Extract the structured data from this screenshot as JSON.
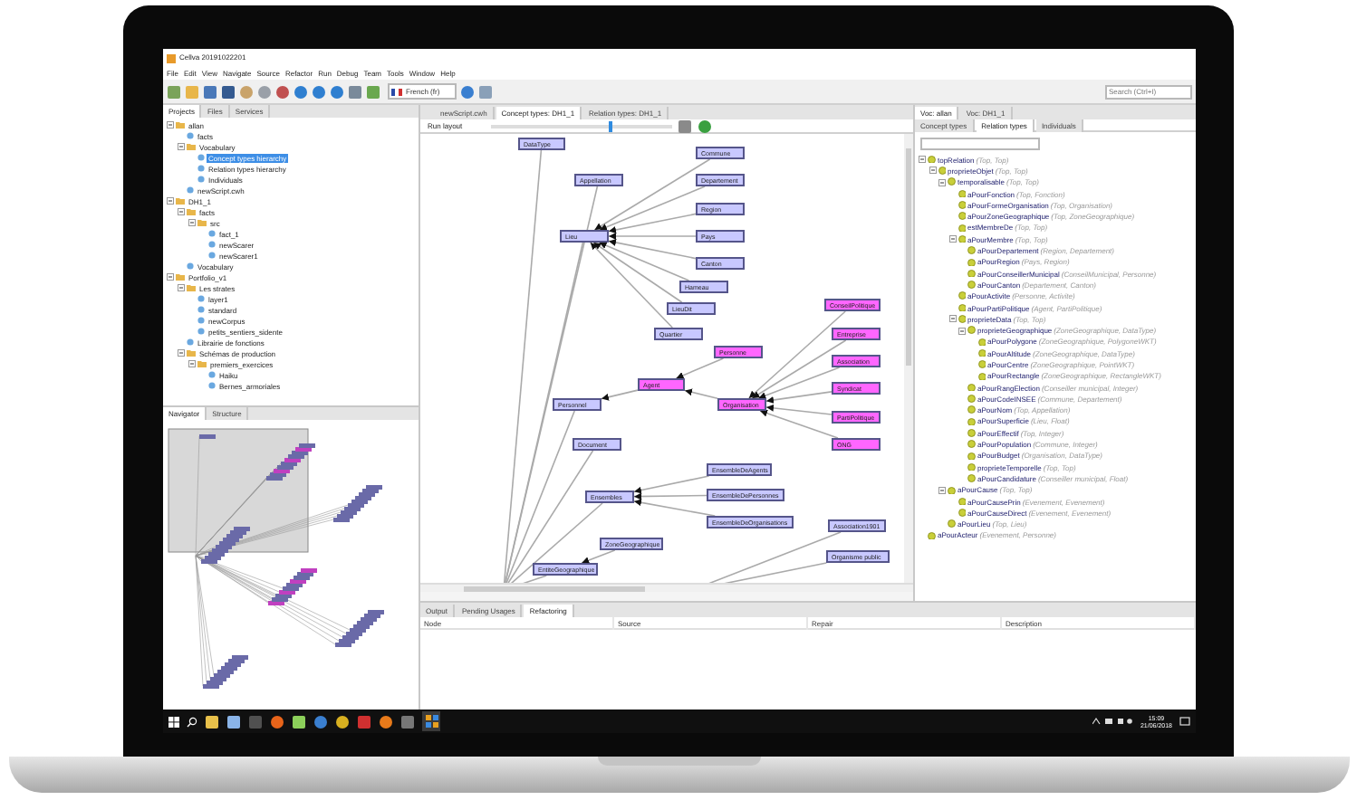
{
  "window": {
    "title": "Cellva 20191022201"
  },
  "menu": [
    "File",
    "Edit",
    "View",
    "Navigate",
    "Source",
    "Refactor",
    "Run",
    "Debug",
    "Team",
    "Tools",
    "Window",
    "Help"
  ],
  "toolbar": {
    "language": "French (fr)",
    "search": {
      "placeholder": "Search (Ctrl+I)"
    }
  },
  "projects_panel": {
    "tabs": [
      {
        "label": "Projects",
        "selected": true
      },
      {
        "label": "Files",
        "selected": false
      },
      {
        "label": "Services",
        "selected": false
      }
    ],
    "tree": [
      {
        "label": "allan",
        "selected": false,
        "children": [
          {
            "label": "facts",
            "selected": false
          },
          {
            "label": "Vocabulary",
            "selected": false,
            "children": [
              {
                "label": "Concept types hierarchy",
                "selected": true
              },
              {
                "label": "Relation types hierarchy",
                "selected": false
              },
              {
                "label": "Individuals",
                "selected": false
              }
            ]
          },
          {
            "label": "newScript.cwh",
            "selected": false
          }
        ]
      },
      {
        "label": "DH1_1",
        "selected": false,
        "children": [
          {
            "label": "facts",
            "selected": false,
            "children": [
              {
                "label": "src",
                "selected": false,
                "children": [
                  {
                    "label": "fact_1",
                    "selected": false
                  },
                  {
                    "label": "newScarer",
                    "selected": false
                  },
                  {
                    "label": "newScarer1",
                    "selected": false
                  }
                ]
              }
            ]
          },
          {
            "label": "Vocabulary",
            "selected": false
          }
        ]
      },
      {
        "label": "Portfolio_v1",
        "selected": false,
        "children": [
          {
            "label": "Les strates",
            "selected": false,
            "children": [
              {
                "label": "layer1",
                "selected": false
              },
              {
                "label": "standard",
                "selected": false
              },
              {
                "label": "newCorpus",
                "selected": false
              },
              {
                "label": "petits_sentiers_sidente",
                "selected": false
              }
            ]
          },
          {
            "label": "Librairie de fonctions",
            "selected": false
          },
          {
            "label": "Schémas de production",
            "selected": false,
            "children": [
              {
                "label": "premiers_exercices",
                "selected": false,
                "children": [
                  {
                    "label": "Haiku",
                    "selected": false
                  },
                  {
                    "label": "Bernes_armoriales",
                    "selected": false
                  }
                ]
              }
            ]
          }
        ]
      }
    ]
  },
  "navigator_panel": {
    "tabs": [
      {
        "label": "Navigator",
        "selected": true
      },
      {
        "label": "Structure",
        "selected": false
      }
    ]
  },
  "editor": {
    "tabs": [
      {
        "label": "newScript.cwh",
        "selected": false
      },
      {
        "label": "Concept types: DH1_1",
        "selected": true
      },
      {
        "label": "Relation types: DH1_1",
        "selected": false
      }
    ],
    "run_layout": "Run layout",
    "zoom_slider": {
      "level": 0.65
    },
    "graph": {
      "nodes": [
        {
          "label": "DataType",
          "color": "#c8c8ff"
        },
        {
          "label": "Appellation",
          "color": "#c8c8ff"
        },
        {
          "label": "Lieu",
          "color": "#c8c8ff",
          "children": [
            {
              "label": "Commune",
              "color": "#c8c8ff"
            },
            {
              "label": "Departement",
              "color": "#c8c8ff"
            },
            {
              "label": "Region",
              "color": "#c8c8ff"
            },
            {
              "label": "Pays",
              "color": "#c8c8ff"
            },
            {
              "label": "Canton",
              "color": "#c8c8ff"
            },
            {
              "label": "Hameau",
              "color": "#c8c8ff"
            },
            {
              "label": "LieuDit",
              "color": "#c8c8ff"
            },
            {
              "label": "Quartier",
              "color": "#c8c8ff"
            }
          ]
        },
        {
          "label": "Personnel",
          "color": "#c8c8ff",
          "children": [
            {
              "label": "Agent",
              "color": "#ff66ff",
              "children": [
                {
                  "label": "Personne",
                  "color": "#ff66ff"
                },
                {
                  "label": "Organisation",
                  "color": "#ff66ff",
                  "children": [
                    {
                      "label": "ConseilPolitique",
                      "color": "#ff66ff"
                    },
                    {
                      "label": "Entreprise",
                      "color": "#ff66ff"
                    },
                    {
                      "label": "Association",
                      "color": "#ff66ff"
                    },
                    {
                      "label": "Syndicat",
                      "color": "#ff66ff"
                    },
                    {
                      "label": "PartiPolitique",
                      "color": "#ff66ff"
                    },
                    {
                      "label": "ONG",
                      "color": "#ff66ff"
                    }
                  ]
                }
              ]
            }
          ]
        },
        {
          "label": "Document",
          "color": "#c8c8ff"
        },
        {
          "label": "Ensembles",
          "color": "#c8c8ff",
          "children": [
            {
              "label": "EnsembleDeAgents",
              "color": "#c8c8ff"
            },
            {
              "label": "EnsembleDePersonnes",
              "color": "#c8c8ff"
            },
            {
              "label": "EnsembleDeOrganisations",
              "color": "#c8c8ff"
            }
          ]
        },
        {
          "label": "EntiteGeographique",
          "color": "#c8c8ff",
          "children": [
            {
              "label": "ZoneGeographique",
              "color": "#c8c8ff"
            }
          ]
        },
        {
          "label": "Association1901",
          "color": "#c8c8ff"
        },
        {
          "label": "Organisme public",
          "color": "#c8c8ff"
        }
      ]
    }
  },
  "vocabulary_panel": {
    "tabs": [
      {
        "label": "Voc: allan",
        "selected": true
      },
      {
        "label": "Voc: DH1_1",
        "selected": false
      }
    ],
    "subtabs": [
      {
        "label": "Concept types",
        "selected": false
      },
      {
        "label": "Relation types",
        "selected": true
      },
      {
        "label": "Individuals",
        "selected": false
      }
    ],
    "tree": [
      {
        "name": "topRelation",
        "signature": "(Top, Top)",
        "children": [
          {
            "name": "proprieteObjet",
            "signature": "(Top, Top)",
            "children": [
              {
                "name": "temporalisable",
                "signature": "(Top, Top)",
                "children": [
                  {
                    "name": "aPourFonction",
                    "signature": "(Top, Fonction)"
                  },
                  {
                    "name": "aPourFormeOrganisation",
                    "signature": "(Top, Organisation)"
                  },
                  {
                    "name": "aPourZoneGeographique",
                    "signature": "(Top, ZoneGeographique)"
                  },
                  {
                    "name": "estMembreDe",
                    "signature": "(Top, Top)"
                  },
                  {
                    "name": "aPourMembre",
                    "signature": "(Top, Top)",
                    "children": [
                      {
                        "name": "aPourDepartement",
                        "signature": "(Region, Departement)"
                      },
                      {
                        "name": "aPourRegion",
                        "signature": "(Pays, Region)"
                      },
                      {
                        "name": "aPourConseillerMunicipal",
                        "signature": "(ConseilMunicipal, Personne)"
                      },
                      {
                        "name": "aPourCanton",
                        "signature": "(Departement, Canton)"
                      }
                    ]
                  },
                  {
                    "name": "aPourActivite",
                    "signature": "(Personne, Activite)"
                  },
                  {
                    "name": "aPourPartiPolitique",
                    "signature": "(Agent, PartiPolitique)"
                  },
                  {
                    "name": "proprieteData",
                    "signature": "(Top, Top)",
                    "children": [
                      {
                        "name": "proprieteGeographique",
                        "signature": "(ZoneGeographique, DataType)",
                        "children": [
                          {
                            "name": "aPourPolygone",
                            "signature": "(ZoneGeographique, PolygoneWKT)"
                          },
                          {
                            "name": "aPourAltitude",
                            "signature": "(ZoneGeographique, DataType)"
                          },
                          {
                            "name": "aPourCentre",
                            "signature": "(ZoneGeographique, PointWKT)"
                          },
                          {
                            "name": "aPourRectangle",
                            "signature": "(ZoneGeographique, RectangleWKT)"
                          }
                        ]
                      },
                      {
                        "name": "aPourRangElection",
                        "signature": "(Conseiller municipal, Integer)"
                      },
                      {
                        "name": "aPourCodeINSEE",
                        "signature": "(Commune, Departement)"
                      },
                      {
                        "name": "aPourNom",
                        "signature": "(Top, Appellation)"
                      },
                      {
                        "name": "aPourSuperficie",
                        "signature": "(Lieu, Float)"
                      },
                      {
                        "name": "aPourEffectif",
                        "signature": "(Top, Integer)"
                      },
                      {
                        "name": "aPourPopulation",
                        "signature": "(Commune, Integer)"
                      },
                      {
                        "name": "aPourBudget",
                        "signature": "(Organisation, DataType)"
                      },
                      {
                        "name": "proprieteTemporelle",
                        "signature": "(Top, Top)"
                      },
                      {
                        "name": "aPourCandidature",
                        "signature": "(Conseiller municipal, Float)"
                      }
                    ]
                  }
                ]
              },
              {
                "name": "aPourCause",
                "signature": "(Top, Top)",
                "children": [
                  {
                    "name": "aPourCausePrin",
                    "signature": "(Evenement, Evenement)"
                  },
                  {
                    "name": "aPourCauseDirect",
                    "signature": "(Evenement, Evenement)"
                  }
                ]
              },
              {
                "name": "aPourLieu",
                "signature": "(Top, Lieu)"
              }
            ]
          }
        ]
      },
      {
        "name": "aPourActeur",
        "signature": "(Evenement, Personne)"
      }
    ]
  },
  "output_panel": {
    "tabs": [
      {
        "label": "Output",
        "selected": false
      },
      {
        "label": "Pending Usages",
        "selected": false
      },
      {
        "label": "Refactoring",
        "selected": true
      }
    ],
    "columns": [
      "Node",
      "Source",
      "Repair",
      "Description"
    ]
  },
  "taskbar": {
    "time": "15:09",
    "date": "21/06/2018"
  }
}
